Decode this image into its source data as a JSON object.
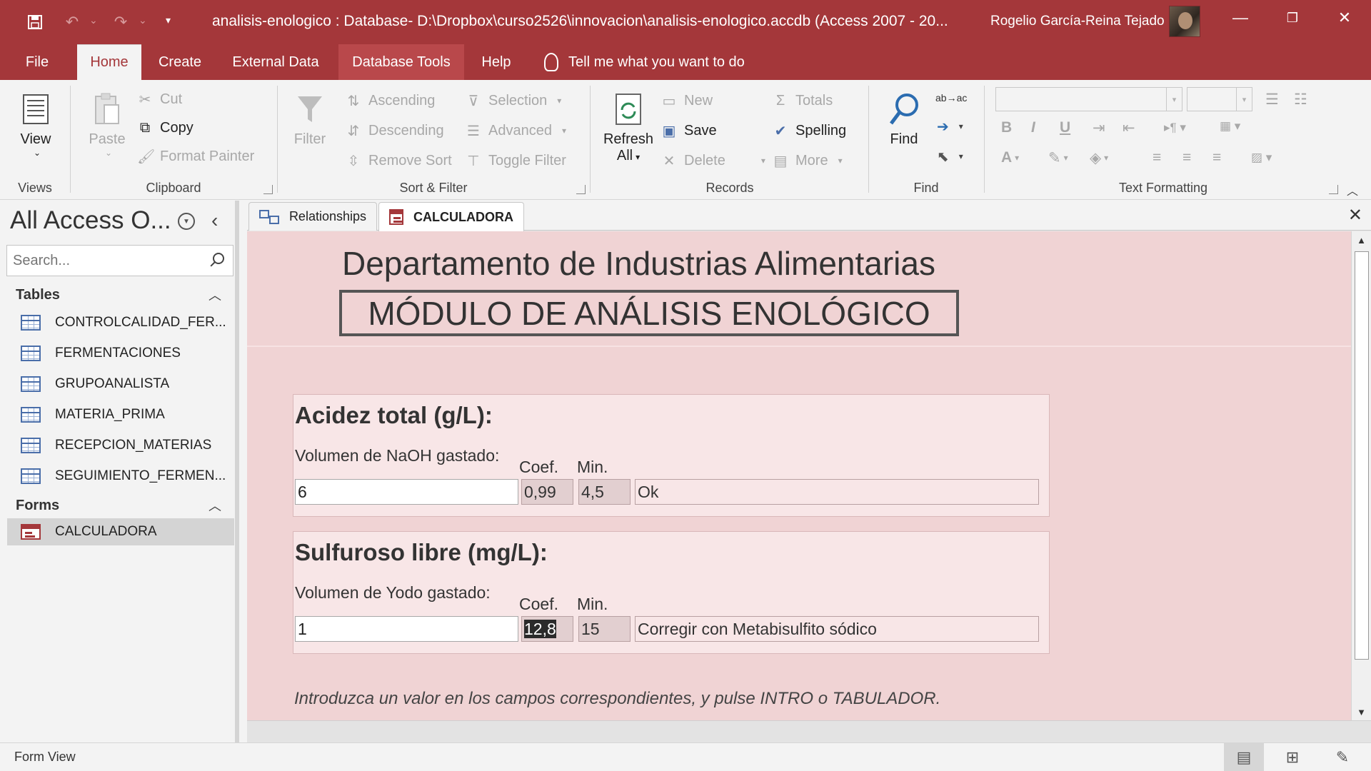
{
  "window": {
    "title": "analisis-enologico : Database- D:\\Dropbox\\curso2526\\innovacion\\analisis-enologico.accdb (Access 2007 - 20...",
    "user": "Rogelio García-Reina Tejado"
  },
  "qat": {
    "save_icon": "save-icon",
    "undo_icon": "undo-icon",
    "redo_icon": "redo-icon",
    "customize_icon": "customize-icon"
  },
  "ribbon_tabs": [
    "File",
    "Home",
    "Create",
    "External Data",
    "Database Tools",
    "Help"
  ],
  "active_tab": "Home",
  "tell_me": "Tell me what you want to do",
  "ribbon": {
    "views": {
      "view": "View",
      "label": "Views"
    },
    "clipboard": {
      "paste": "Paste",
      "cut": "Cut",
      "copy": "Copy",
      "format_painter": "Format Painter",
      "label": "Clipboard"
    },
    "sort_filter": {
      "filter": "Filter",
      "ascending": "Ascending",
      "descending": "Descending",
      "remove_sort": "Remove Sort",
      "selection": "Selection",
      "advanced": "Advanced",
      "toggle_filter": "Toggle Filter",
      "label": "Sort & Filter"
    },
    "records": {
      "refresh": "Refresh",
      "refresh_sub": "All",
      "new": "New",
      "save": "Save",
      "delete": "Delete",
      "totals": "Totals",
      "spelling": "Spelling",
      "more": "More",
      "label": "Records"
    },
    "find": {
      "find": "Find",
      "label": "Find"
    },
    "text_formatting": {
      "bold": "B",
      "italic": "I",
      "underline": "U",
      "font_color": "A",
      "label": "Text Formatting"
    }
  },
  "nav": {
    "title": "All Access O...",
    "search_placeholder": "Search...",
    "tables_header": "Tables",
    "tables": [
      "CONTROLCALIDAD_FER...",
      "FERMENTACIONES",
      "GRUPOANALISTA",
      "MATERIA_PRIMA",
      "RECEPCION_MATERIAS",
      "SEGUIMIENTO_FERMEN..."
    ],
    "forms_header": "Forms",
    "forms": [
      "CALCULADORA"
    ],
    "selected_form": "CALCULADORA"
  },
  "doc_tabs": [
    "Relationships",
    "CALCULADORA"
  ],
  "active_doc_tab": "CALCULADORA",
  "form": {
    "dept_title": "Departamento de Industrias Alimentarias",
    "module_title": "MÓDULO DE ANÁLISIS ENOLÓGICO",
    "acidez": {
      "title": "Acidez total (g/L):",
      "label": "Volumen de NaOH gastado:",
      "coef_label": "Coef.",
      "min_label": "Min.",
      "value": "6",
      "coef": "0,99",
      "min": "4,5",
      "result": "Ok"
    },
    "sulfuroso": {
      "title": "Sulfuroso libre (mg/L):",
      "label": "Volumen de Yodo gastado:",
      "coef_label": "Coef.",
      "min_label": "Min.",
      "value": "1",
      "coef": "12,8",
      "min": "15",
      "result": "Corregir con Metabisulfito sódico"
    },
    "instruction": "Introduzca un valor en los campos correspondientes, y pulse INTRO o TABULADOR."
  },
  "status": {
    "text": "Form View"
  },
  "colors": {
    "accent": "#a4373a",
    "form_bg": "#f0d3d4",
    "panel_bg": "#f8e6e7"
  }
}
